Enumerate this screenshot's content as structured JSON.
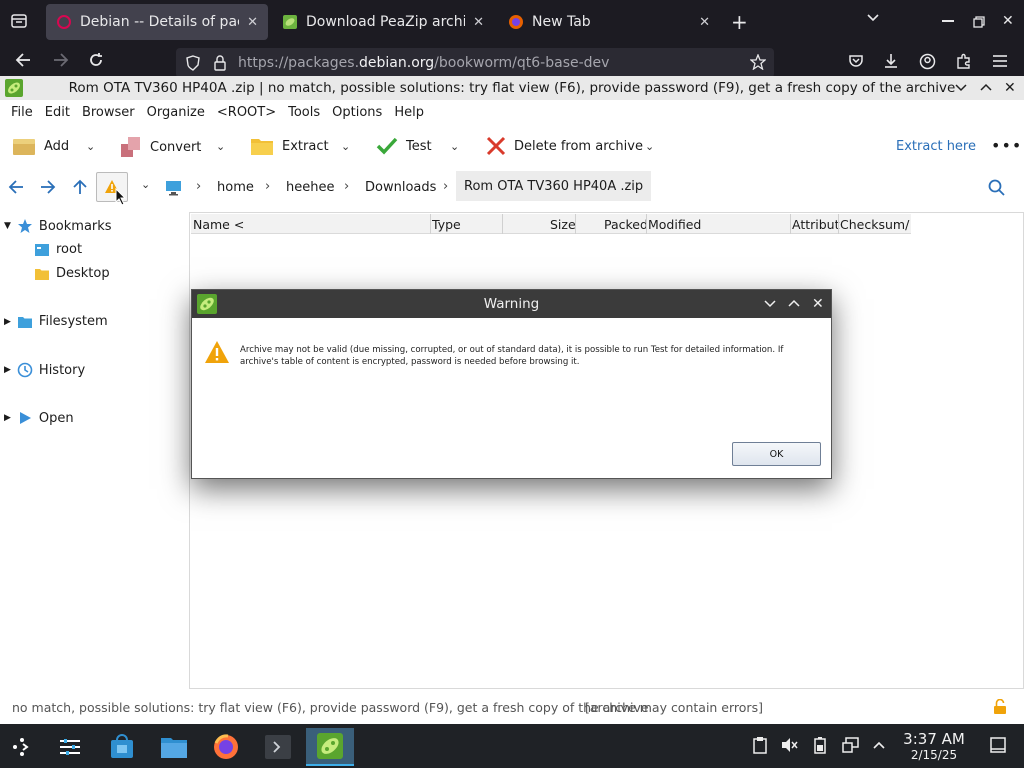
{
  "browser": {
    "tabs": [
      {
        "label": "Debian -- Details of packa",
        "active": true
      },
      {
        "label": "Download PeaZip archive",
        "active": false
      },
      {
        "label": "New Tab",
        "active": false
      }
    ],
    "url": {
      "prefix": "https://packages.",
      "domain": "debian.org",
      "path": "/bookworm/qt6-base-dev"
    }
  },
  "peazip": {
    "window_title": "Rom OTA TV360 HP40A .zip | no match, possible solutions: try flat view (F6), provide password (F9), get a fresh copy of the archive",
    "menu": [
      "File",
      "Edit",
      "Browser",
      "Organize",
      "<ROOT>",
      "Tools",
      "Options",
      "Help"
    ],
    "toolbar": {
      "add": "Add",
      "convert": "Convert",
      "extract": "Extract",
      "test": "Test",
      "delete": "Delete from archive",
      "extract_here": "Extract here"
    },
    "breadcrumb": [
      "home",
      "heehee",
      "Downloads",
      "Rom OTA TV360 HP40A .zip"
    ],
    "sidebar": {
      "bookmarks": "Bookmarks",
      "root": "root",
      "desktop": "Desktop",
      "filesystem": "Filesystem",
      "history": "History",
      "open": "Open"
    },
    "columns": [
      "Name <",
      "Type",
      "Size",
      "Packed",
      "Modified",
      "Attribut",
      "Checksum/h"
    ],
    "status": {
      "message": "no match, possible solutions: try flat view (F6), provide password (F9), get a fresh copy of the archive",
      "note": "[archive may contain errors]"
    }
  },
  "dialog": {
    "title": "Warning",
    "message": "Archive may not be valid (due missing, corrupted, or out of standard data), it is possible to run Test for detailed information. If archive's table of content is encrypted, password is needed before browsing it.",
    "ok": "OK"
  },
  "taskbar": {
    "time": "3:37 AM",
    "date": "2/15/25"
  },
  "colors": {
    "accent": "#3daee9",
    "link": "#2a6fb8",
    "warning": "#f0a30a",
    "delete_red": "#d93a2b",
    "test_green": "#3aa83a"
  }
}
